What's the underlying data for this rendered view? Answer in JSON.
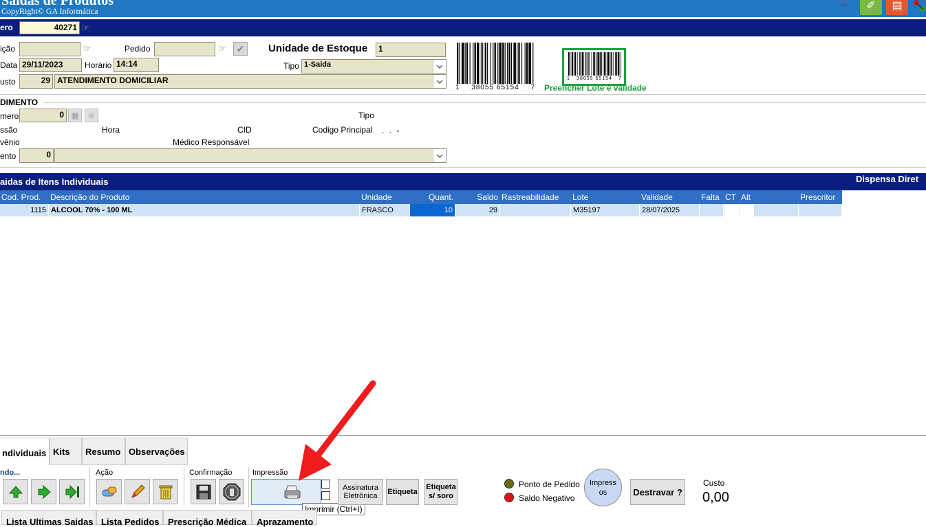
{
  "title_bar": {
    "title": "Saídas de Produtos",
    "copyright": "CopyRight© GA Informática"
  },
  "header": {
    "numero_label": "ero",
    "numero_value": "40271"
  },
  "form": {
    "requisicao_label": "ição",
    "pedido_label": "Pedido",
    "unidade_estoque_label": "Unidade de Estoque",
    "unidade_estoque_value": "1",
    "data_label": "Data",
    "data_value": "29/11/2023",
    "horario_label": "Horário",
    "horario_value": "14:14",
    "tipo_label": "Tipo",
    "tipo_value": "1-Saida",
    "custo_label": "usto",
    "custo_code": "29",
    "custo_desc": "ATENDIMENTO DOMICILIAR",
    "barcode_number": "38055 65154",
    "barcode_prefix": "1",
    "barcode_suffix": "7",
    "preencher_label": "Preencher Lote e validade"
  },
  "atendimento": {
    "section_title": "DIMENTO",
    "numero_label": "mero",
    "numero_value": "0",
    "tipo_label": "Tipo",
    "admissao_label": "ssão",
    "hora_label": "Hora",
    "cid_label": "CID",
    "codigo_principal_label": "Codigo Principal",
    "codigo_principal_value": ". . -",
    "convenio_label": "vênio",
    "medico_label": "Médico Responsável",
    "paciente_label": "ento",
    "paciente_value": "0"
  },
  "items_section": {
    "title": "aidas de Itens Individuais",
    "right_title": "Dispensa Diret",
    "columns": [
      "Cod. Prod.",
      "Descrição do Produto",
      "Unidade",
      "Quant.",
      "Saldo",
      "Rastreabilidade",
      "Lote",
      "Validade",
      "Falta",
      "CT",
      "Alt",
      "Prescritor"
    ],
    "rows": [
      {
        "cod": "1115",
        "descricao": "ALCOOL 70% - 100 ML",
        "unidade": "FRASCO",
        "quant": "10",
        "saldo": "29",
        "rastreabilidade": "",
        "lote": "M35197",
        "validade": "28/07/2025"
      }
    ]
  },
  "tabs": [
    "ndividuais",
    "Kits",
    "Resumo",
    "Observações"
  ],
  "toolbar": {
    "navegando_label": "ndo...",
    "acao_label": "Ação",
    "confirmacao_label": "Confirmação",
    "impressao_label": "Impressão",
    "assinatura_label": "Assinatura Eletrônica",
    "etiqueta_label": "Etiqueta",
    "etiqueta_soro_label": "Etiqueta s/ soro",
    "ponto_pedido_label": "Ponto de Pedido",
    "saldo_negativo_label": "Saldo Negativo",
    "impressos_label": "Impressos",
    "destravar_label": "Destravar ?",
    "custo_label": "Custo",
    "custo_value": "0,00",
    "tooltip": "Imprimir (Ctrl+I)"
  },
  "bottom_tabs": [
    "Lista Ultimas Saidas",
    "Lista Pedidos",
    "Prescrição Médica",
    "Aprazamento"
  ],
  "colors": {
    "title_bar": "#1f78c1",
    "header_band": "#0a1e7e",
    "field_bg": "#e7e5c9",
    "grid_header": "#2f6fc4",
    "grid_row": "#cfe3f7",
    "selected_cell": "#0a66d0",
    "barcode_box": "#20a040",
    "arrow": "#ee1c1c",
    "ponto_pedido": "#6b6b10",
    "saldo_negativo": "#e01010"
  }
}
